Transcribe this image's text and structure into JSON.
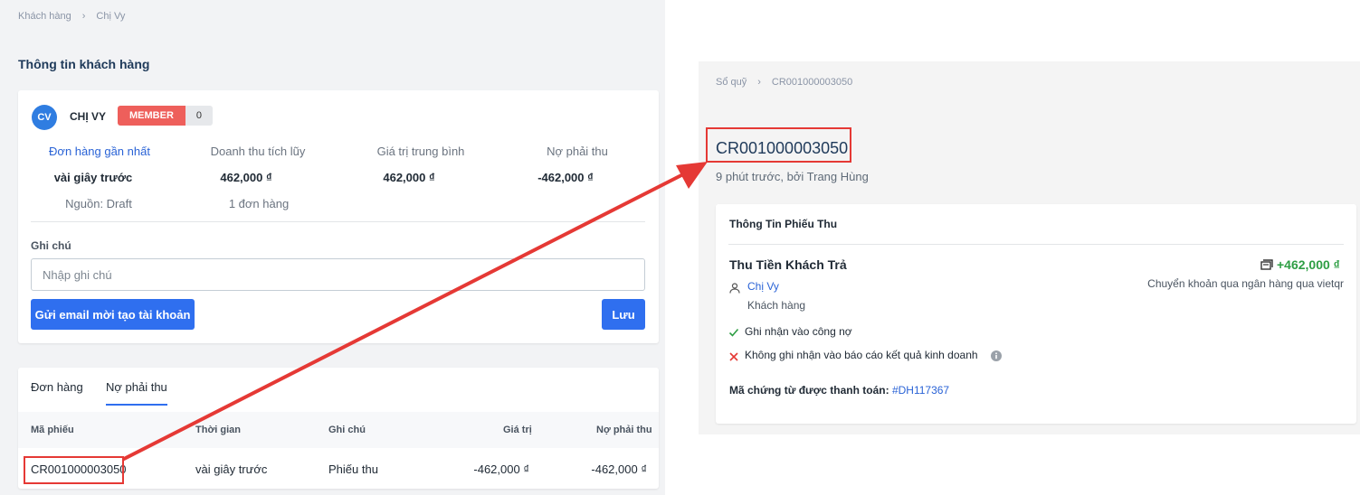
{
  "left": {
    "breadcrumb": [
      "Khách hàng",
      "Chị Vy"
    ],
    "section_title": "Thông tin khách hàng",
    "customer": {
      "initials": "CV",
      "name": "CHỊ VY",
      "badge": "MEMBER",
      "badge_count": "0"
    },
    "stats": {
      "headers": [
        "Đơn hàng gần nhất",
        "Doanh thu tích lũy",
        "Giá trị trung bình",
        "Nợ phải thu"
      ],
      "values": [
        "vài giây trước",
        "462,000 ₫",
        "462,000 ₫",
        "-462,000 ₫"
      ],
      "sub": [
        "Nguồn: Draft",
        "1 đơn hàng"
      ]
    },
    "note": {
      "label": "Ghi chú",
      "placeholder": "Nhập ghi chú"
    },
    "buttons": {
      "email": "Gửi email mời tạo tài khoản",
      "save": "Lưu"
    },
    "tabs": [
      "Đơn hàng",
      "Nợ phải thu"
    ],
    "table": {
      "headers": [
        "Mã phiếu",
        "Thời gian",
        "Ghi chú",
        "Giá trị",
        "Nợ phải thu"
      ],
      "rows": [
        [
          "CR001000003050",
          "vài giây trước",
          "Phiếu thu",
          "-462,000 ₫",
          "-462,000 ₫"
        ]
      ]
    }
  },
  "right": {
    "breadcrumb": [
      "Sổ quỹ",
      "CR001000003050"
    ],
    "code": "CR001000003050",
    "subtitle": "9 phút trước, bởi Trang Hùng",
    "card_title": "Thông Tin Phiếu Thu",
    "type": "Thu Tiền Khách Trả",
    "amount": "+462,000 ₫",
    "method": "Chuyển khoản qua ngân hàng qua vietqr",
    "person": "Chị Vy",
    "person_role": "Khách hàng",
    "check1": "Ghi nhận vào công nợ",
    "check2": "Không ghi nhận vào báo cáo kết quả kinh doanh",
    "voucher_label": "Mã chứng từ được thanh toán:",
    "voucher_code": "#DH117367"
  },
  "colors": {
    "accent": "#2f6fef",
    "annotation": "#e53935",
    "positive": "#2e9e44",
    "member_badge": "#ee5f5b"
  }
}
